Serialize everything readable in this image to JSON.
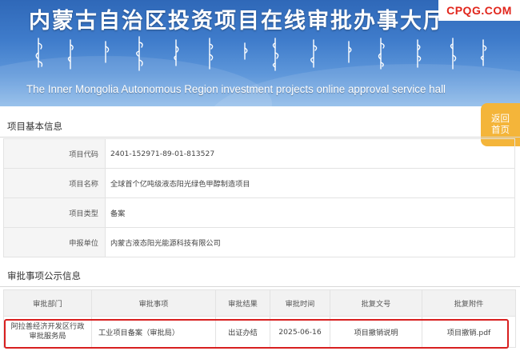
{
  "banner": {
    "title": "内蒙古自治区投资项目在线审批办事大厅",
    "subtitle": "The Inner Mongolia Autonomous Region investment projects online approval service hall",
    "watermark": "CPQG.COM"
  },
  "back_button": {
    "line1": "返回",
    "line2": "首页"
  },
  "project_section": {
    "title": "项目基本信息",
    "rows": [
      {
        "label": "项目代码",
        "value": "2401-152971-89-01-813527"
      },
      {
        "label": "项目名称",
        "value": "全球首个亿吨级液态阳光绿色甲醇制造项目"
      },
      {
        "label": "项目类型",
        "value": "备案"
      },
      {
        "label": "申报单位",
        "value": "内蒙古液态阳光能源科技有限公司"
      }
    ]
  },
  "approval_section": {
    "title": "审批事项公示信息",
    "columns": [
      "审批部门",
      "审批事项",
      "审批结果",
      "审批时间",
      "批复文号",
      "批复附件"
    ],
    "rows": [
      {
        "department_line1": "阿拉善经济开发区行政",
        "department_line2": "审批服务局",
        "item": "工业项目备案（审批局）",
        "result": "出证办结",
        "date": "2025-06-16",
        "doc_no": "项目撤销说明",
        "attachment": "项目撤销.pdf"
      }
    ]
  },
  "colors": {
    "banner": "#3f7ccb",
    "back_button": "#f4b53a",
    "highlight": "#d81f1f",
    "watermark": "#e1251b"
  }
}
